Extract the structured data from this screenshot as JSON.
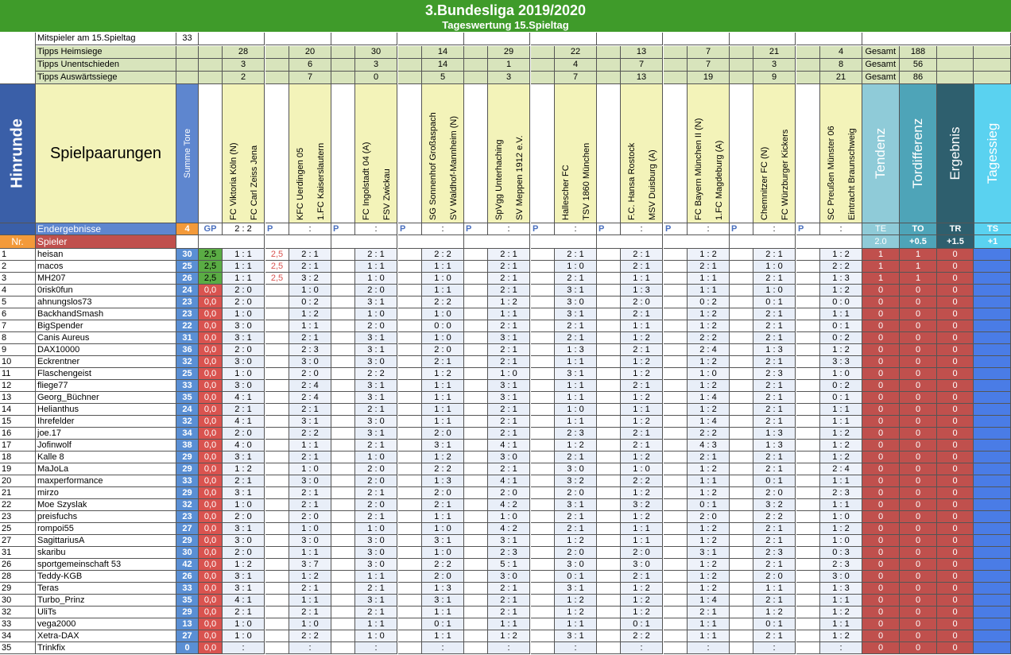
{
  "title": "3.Bundesliga 2019/2020",
  "subtitle": "Tageswertung 15.Spieltag",
  "info": {
    "players_label": "Mitspieler am 15.Spieltag",
    "players_count": "33",
    "home_label": "Tipps Heimsiege",
    "draw_label": "Tipps Unentschieden",
    "away_label": "Tipps Auswärtssiege",
    "gesamt_label": "Gesamt",
    "home_total": "188",
    "draw_total": "56",
    "away_total": "86"
  },
  "header": {
    "hinrunde": "Hinrunde",
    "spielpaarungen": "Spielpaarungen",
    "summe_tore": "Summe Tore",
    "tendenz": "Tendenz",
    "tordifferenz": "Tordifferenz",
    "ergebnis": "Ergebnis",
    "tagessieg": "Tagessieg"
  },
  "matches": [
    {
      "home": "FC Viktoria Köln (N)",
      "away": "FC Carl Zeiss Jena",
      "h": "28",
      "d": "3",
      "a": "2",
      "result": "2  :  2"
    },
    {
      "home": "KFC Uerdingen 05",
      "away": "1.FC Kaiserslautern",
      "h": "20",
      "d": "6",
      "a": "7",
      "result": ":"
    },
    {
      "home": "FC Ingolstadt 04 (A)",
      "away": "FSV Zwickau",
      "h": "30",
      "d": "3",
      "a": "0",
      "result": ":"
    },
    {
      "home": "SG Sonnenhof Großaspach",
      "away": "SV Waldhof-Mannheim (N)",
      "h": "14",
      "d": "14",
      "a": "5",
      "result": ":"
    },
    {
      "home": "SpVgg Unterhaching",
      "away": "SV Meppen 1912 e.V.",
      "h": "29",
      "d": "1",
      "a": "3",
      "result": ":"
    },
    {
      "home": "Hallescher FC",
      "away": "TSV 1860 München",
      "h": "22",
      "d": "4",
      "a": "7",
      "result": ":"
    },
    {
      "home": "F.C. Hansa Rostock",
      "away": "MSV Duisburg (A)",
      "h": "13",
      "d": "7",
      "a": "13",
      "result": ":"
    },
    {
      "home": "FC Bayern München II (N)",
      "away": "1.FC Magdeburg (A)",
      "h": "7",
      "d": "7",
      "a": "19",
      "result": ":"
    },
    {
      "home": "Chemnitzer FC (N)",
      "away": "FC Würzburger Kickers",
      "h": "21",
      "d": "3",
      "a": "9",
      "result": ":"
    },
    {
      "home": "SC Preußen Münster 06",
      "away": "Eintracht Braunschweig",
      "h": "4",
      "d": "8",
      "a": "21",
      "result": ":"
    }
  ],
  "endergebnisse": {
    "label": "Endergebnisse",
    "sum": "4",
    "gp": "GP",
    "p": "P",
    "te": "TE",
    "to": "TO",
    "tr": "TR",
    "ts": "TS",
    "te_val": "2.0",
    "to_val": "+0.5",
    "tr_val": "+1.5",
    "ts_val": "+1"
  },
  "spieler_header": {
    "nr": "Nr.",
    "spieler": "Spieler"
  },
  "players": [
    {
      "nr": "1",
      "name": "heisan",
      "sum": "30",
      "gp": "2,5",
      "p1": "2,5",
      "tips": [
        "1 : 1",
        "2 : 1",
        "2 : 1",
        "2 : 2",
        "2 : 1",
        "2 : 1",
        "2 : 1",
        "1 : 2",
        "2 : 1",
        "1 : 2"
      ],
      "te": "1",
      "to": "1",
      "tr": "0"
    },
    {
      "nr": "2",
      "name": "macos",
      "sum": "25",
      "gp": "2,5",
      "p1": "2,5",
      "tips": [
        "1 : 1",
        "2 : 1",
        "1 : 1",
        "1 : 1",
        "2 : 1",
        "1 : 0",
        "2 : 1",
        "2 : 1",
        "1 : 0",
        "2 : 2"
      ],
      "te": "1",
      "to": "1",
      "tr": "0"
    },
    {
      "nr": "3",
      "name": "MH207",
      "sum": "26",
      "gp": "2,5",
      "p1": "2,5",
      "tips": [
        "1 : 1",
        "3 : 2",
        "1 : 0",
        "1 : 0",
        "2 : 1",
        "2 : 1",
        "1 : 1",
        "1 : 1",
        "2 : 1",
        "1 : 3"
      ],
      "te": "1",
      "to": "1",
      "tr": "0"
    },
    {
      "nr": "4",
      "name": "0risk0fun",
      "sum": "24",
      "gp": "0,0",
      "p1": "",
      "tips": [
        "2 : 0",
        "1 : 0",
        "2 : 0",
        "1 : 1",
        "2 : 1",
        "3 : 1",
        "1 : 3",
        "1 : 1",
        "1 : 0",
        "1 : 2"
      ],
      "te": "0",
      "to": "0",
      "tr": "0"
    },
    {
      "nr": "5",
      "name": "ahnungslos73",
      "sum": "23",
      "gp": "0,0",
      "p1": "",
      "tips": [
        "2 : 0",
        "0 : 2",
        "3 : 1",
        "2 : 2",
        "1 : 2",
        "3 : 0",
        "2 : 0",
        "0 : 2",
        "0 : 1",
        "0 : 0"
      ],
      "te": "0",
      "to": "0",
      "tr": "0"
    },
    {
      "nr": "6",
      "name": "BackhandSmash",
      "sum": "23",
      "gp": "0,0",
      "p1": "",
      "tips": [
        "1 : 0",
        "1 : 2",
        "1 : 0",
        "1 : 0",
        "1 : 1",
        "3 : 1",
        "2 : 1",
        "1 : 2",
        "2 : 1",
        "1 : 1"
      ],
      "te": "0",
      "to": "0",
      "tr": "0"
    },
    {
      "nr": "7",
      "name": "BigSpender",
      "sum": "22",
      "gp": "0,0",
      "p1": "",
      "tips": [
        "3 : 0",
        "1 : 1",
        "2 : 0",
        "0 : 0",
        "2 : 1",
        "2 : 1",
        "1 : 1",
        "1 : 2",
        "2 : 1",
        "0 : 1"
      ],
      "te": "0",
      "to": "0",
      "tr": "0"
    },
    {
      "nr": "8",
      "name": "Canis Aureus",
      "sum": "31",
      "gp": "0,0",
      "p1": "",
      "tips": [
        "3 : 1",
        "2 : 1",
        "3 : 1",
        "1 : 0",
        "3 : 1",
        "2 : 1",
        "1 : 2",
        "2 : 2",
        "2 : 1",
        "0 : 2"
      ],
      "te": "0",
      "to": "0",
      "tr": "0"
    },
    {
      "nr": "9",
      "name": "DAX10000",
      "sum": "36",
      "gp": "0,0",
      "p1": "",
      "tips": [
        "2 : 0",
        "2 : 3",
        "3 : 1",
        "2 : 0",
        "2 : 1",
        "1 : 3",
        "2 : 1",
        "2 : 4",
        "1 : 3",
        "1 : 2"
      ],
      "te": "0",
      "to": "0",
      "tr": "0"
    },
    {
      "nr": "10",
      "name": "Eckrentner",
      "sum": "32",
      "gp": "0,0",
      "p1": "",
      "tips": [
        "3 : 0",
        "3 : 0",
        "3 : 0",
        "2 : 1",
        "2 : 1",
        "1 : 1",
        "1 : 2",
        "1 : 2",
        "2 : 1",
        "3 : 3"
      ],
      "te": "0",
      "to": "0",
      "tr": "0"
    },
    {
      "nr": "11",
      "name": "Flaschengeist",
      "sum": "25",
      "gp": "0,0",
      "p1": "",
      "tips": [
        "1 : 0",
        "2 : 0",
        "2 : 2",
        "1 : 2",
        "1 : 0",
        "3 : 1",
        "1 : 2",
        "1 : 0",
        "2 : 3",
        "1 : 0"
      ],
      "te": "0",
      "to": "0",
      "tr": "0"
    },
    {
      "nr": "12",
      "name": "fliege77",
      "sum": "33",
      "gp": "0,0",
      "p1": "",
      "tips": [
        "3 : 0",
        "2 : 4",
        "3 : 1",
        "1 : 1",
        "3 : 1",
        "1 : 1",
        "2 : 1",
        "1 : 2",
        "2 : 1",
        "0 : 2"
      ],
      "te": "0",
      "to": "0",
      "tr": "0"
    },
    {
      "nr": "13",
      "name": "Georg_Büchner",
      "sum": "35",
      "gp": "0,0",
      "p1": "",
      "tips": [
        "4 : 1",
        "2 : 4",
        "3 : 1",
        "1 : 1",
        "3 : 1",
        "1 : 1",
        "1 : 2",
        "1 : 4",
        "2 : 1",
        "0 : 1"
      ],
      "te": "0",
      "to": "0",
      "tr": "0"
    },
    {
      "nr": "14",
      "name": "Helianthus",
      "sum": "24",
      "gp": "0,0",
      "p1": "",
      "tips": [
        "2 : 1",
        "2 : 1",
        "2 : 1",
        "1 : 1",
        "2 : 1",
        "1 : 0",
        "1 : 1",
        "1 : 2",
        "2 : 1",
        "1 : 1"
      ],
      "te": "0",
      "to": "0",
      "tr": "0"
    },
    {
      "nr": "15",
      "name": "Ihrefelder",
      "sum": "32",
      "gp": "0,0",
      "p1": "",
      "tips": [
        "4 : 1",
        "3 : 1",
        "3 : 0",
        "1 : 1",
        "2 : 1",
        "1 : 1",
        "1 : 2",
        "1 : 4",
        "2 : 1",
        "1 : 1"
      ],
      "te": "0",
      "to": "0",
      "tr": "0"
    },
    {
      "nr": "16",
      "name": "joe.17",
      "sum": "34",
      "gp": "0,0",
      "p1": "",
      "tips": [
        "2 : 0",
        "2 : 2",
        "3 : 1",
        "2 : 0",
        "2 : 1",
        "2 : 3",
        "2 : 1",
        "2 : 2",
        "1 : 3",
        "1 : 2"
      ],
      "te": "0",
      "to": "0",
      "tr": "0"
    },
    {
      "nr": "17",
      "name": "Jofinwolf",
      "sum": "38",
      "gp": "0,0",
      "p1": "",
      "tips": [
        "4 : 0",
        "1 : 1",
        "2 : 1",
        "3 : 1",
        "4 : 1",
        "1 : 2",
        "2 : 1",
        "4 : 3",
        "1 : 3",
        "1 : 2"
      ],
      "te": "0",
      "to": "0",
      "tr": "0"
    },
    {
      "nr": "18",
      "name": "Kalle 8",
      "sum": "29",
      "gp": "0,0",
      "p1": "",
      "tips": [
        "3 : 1",
        "2 : 1",
        "1 : 0",
        "1 : 2",
        "3 : 0",
        "2 : 1",
        "1 : 2",
        "2 : 1",
        "2 : 1",
        "1 : 2"
      ],
      "te": "0",
      "to": "0",
      "tr": "0"
    },
    {
      "nr": "19",
      "name": "MaJoLa",
      "sum": "29",
      "gp": "0,0",
      "p1": "",
      "tips": [
        "1 : 2",
        "1 : 0",
        "2 : 0",
        "2 : 2",
        "2 : 1",
        "3 : 0",
        "1 : 0",
        "1 : 2",
        "2 : 1",
        "2 : 4"
      ],
      "te": "0",
      "to": "0",
      "tr": "0"
    },
    {
      "nr": "20",
      "name": "maxperformance",
      "sum": "33",
      "gp": "0,0",
      "p1": "",
      "tips": [
        "2 : 1",
        "3 : 0",
        "2 : 0",
        "1 : 3",
        "4 : 1",
        "3 : 2",
        "2 : 2",
        "1 : 1",
        "0 : 1",
        "1 : 1"
      ],
      "te": "0",
      "to": "0",
      "tr": "0"
    },
    {
      "nr": "21",
      "name": "mirzo",
      "sum": "29",
      "gp": "0,0",
      "p1": "",
      "tips": [
        "3 : 1",
        "2 : 1",
        "2 : 1",
        "2 : 0",
        "2 : 0",
        "2 : 0",
        "1 : 2",
        "1 : 2",
        "2 : 0",
        "2 : 3"
      ],
      "te": "0",
      "to": "0",
      "tr": "0"
    },
    {
      "nr": "22",
      "name": "Moe Szyslak",
      "sum": "32",
      "gp": "0,0",
      "p1": "",
      "tips": [
        "1 : 0",
        "2 : 1",
        "2 : 0",
        "2 : 1",
        "4 : 2",
        "3 : 1",
        "3 : 2",
        "0 : 1",
        "3 : 2",
        "1 : 1"
      ],
      "te": "0",
      "to": "0",
      "tr": "0"
    },
    {
      "nr": "23",
      "name": "preisfuchs",
      "sum": "23",
      "gp": "0,0",
      "p1": "",
      "tips": [
        "2 : 0",
        "2 : 0",
        "2 : 1",
        "1 : 1",
        "1 : 0",
        "2 : 1",
        "1 : 2",
        "2 : 0",
        "2 : 2",
        "1 : 0"
      ],
      "te": "0",
      "to": "0",
      "tr": "0"
    },
    {
      "nr": "25",
      "name": "rompoi55",
      "sum": "27",
      "gp": "0,0",
      "p1": "",
      "tips": [
        "3 : 1",
        "1 : 0",
        "1 : 0",
        "1 : 0",
        "4 : 2",
        "2 : 1",
        "1 : 1",
        "1 : 2",
        "2 : 1",
        "1 : 2"
      ],
      "te": "0",
      "to": "0",
      "tr": "0"
    },
    {
      "nr": "27",
      "name": "SagittariusA",
      "sum": "29",
      "gp": "0,0",
      "p1": "",
      "tips": [
        "3 : 0",
        "3 : 0",
        "3 : 0",
        "3 : 1",
        "3 : 1",
        "1 : 2",
        "1 : 1",
        "1 : 2",
        "2 : 1",
        "1 : 0"
      ],
      "te": "0",
      "to": "0",
      "tr": "0"
    },
    {
      "nr": "31",
      "name": "skaribu",
      "sum": "30",
      "gp": "0,0",
      "p1": "",
      "tips": [
        "2 : 0",
        "1 : 1",
        "3 : 0",
        "1 : 0",
        "2 : 3",
        "2 : 0",
        "2 : 0",
        "3 : 1",
        "2 : 3",
        "0 : 3"
      ],
      "te": "0",
      "to": "0",
      "tr": "0"
    },
    {
      "nr": "26",
      "name": "sportgemeinschaft 53",
      "sum": "42",
      "gp": "0,0",
      "p1": "",
      "tips": [
        "1 : 2",
        "3 : 7",
        "3 : 0",
        "2 : 2",
        "5 : 1",
        "3 : 0",
        "3 : 0",
        "1 : 2",
        "2 : 1",
        "2 : 3"
      ],
      "te": "0",
      "to": "0",
      "tr": "0"
    },
    {
      "nr": "28",
      "name": "Teddy-KGB",
      "sum": "26",
      "gp": "0,0",
      "p1": "",
      "tips": [
        "3 : 1",
        "1 : 2",
        "1 : 1",
        "2 : 0",
        "3 : 0",
        "0 : 1",
        "2 : 1",
        "1 : 2",
        "2 : 0",
        "3 : 0"
      ],
      "te": "0",
      "to": "0",
      "tr": "0"
    },
    {
      "nr": "29",
      "name": "Teras",
      "sum": "33",
      "gp": "0,0",
      "p1": "",
      "tips": [
        "3 : 1",
        "2 : 1",
        "2 : 1",
        "1 : 3",
        "2 : 1",
        "3 : 1",
        "1 : 2",
        "1 : 2",
        "1 : 1",
        "1 : 3"
      ],
      "te": "0",
      "to": "0",
      "tr": "0"
    },
    {
      "nr": "30",
      "name": "Turbo_Prinz",
      "sum": "35",
      "gp": "0,0",
      "p1": "",
      "tips": [
        "4 : 1",
        "1 : 1",
        "3 : 1",
        "3 : 1",
        "2 : 1",
        "1 : 2",
        "1 : 2",
        "1 : 4",
        "2 : 1",
        "1 : 1"
      ],
      "te": "0",
      "to": "0",
      "tr": "0"
    },
    {
      "nr": "32",
      "name": "UliTs",
      "sum": "29",
      "gp": "0,0",
      "p1": "",
      "tips": [
        "2 : 1",
        "2 : 1",
        "2 : 1",
        "1 : 1",
        "2 : 1",
        "1 : 2",
        "1 : 2",
        "2 : 1",
        "1 : 2",
        "1 : 2"
      ],
      "te": "0",
      "to": "0",
      "tr": "0"
    },
    {
      "nr": "33",
      "name": "vega2000",
      "sum": "13",
      "gp": "0,0",
      "p1": "",
      "tips": [
        "1 : 0",
        "1 : 0",
        "1 : 1",
        "0 : 1",
        "1 : 1",
        "1 : 1",
        "0 : 1",
        "1 : 1",
        "0 : 1",
        "1 : 1"
      ],
      "te": "0",
      "to": "0",
      "tr": "0"
    },
    {
      "nr": "34",
      "name": "Xetra-DAX",
      "sum": "27",
      "gp": "0,0",
      "p1": "",
      "tips": [
        "1 : 0",
        "2 : 2",
        "1 : 0",
        "1 : 1",
        "1 : 2",
        "3 : 1",
        "2 : 2",
        "1 : 1",
        "2 : 1",
        "1 : 2"
      ],
      "te": "0",
      "to": "0",
      "tr": "0"
    },
    {
      "nr": "35",
      "name": "Trinkfix",
      "sum": "0",
      "gp": "0,0",
      "p1": "",
      "tips": [
        ":",
        ":",
        ":",
        ":",
        ":",
        ":",
        ":",
        ":",
        ":",
        ":"
      ],
      "te": "0",
      "to": "0",
      "tr": "0"
    }
  ],
  "colors": {
    "title_green": "#3f9b2a",
    "info_green": "#d8e4bc",
    "header_yellow": "#f3f3b9",
    "blue_header": "#5e86cf",
    "hinrunde_blue": "#3a5fa8",
    "orange": "#f39a3a",
    "spieler_red": "#c0504d",
    "te_col": "#8fcbd8",
    "to_col": "#4ea4b8",
    "tr_col": "#2e5f6e",
    "ts_col": "#5ad2f0",
    "ts_body": "#4a7ce6",
    "sum_body": "#5a8fd4",
    "gp_green": "#5aac44",
    "gp_red": "#d9534f",
    "red_body": "#c0504d"
  }
}
